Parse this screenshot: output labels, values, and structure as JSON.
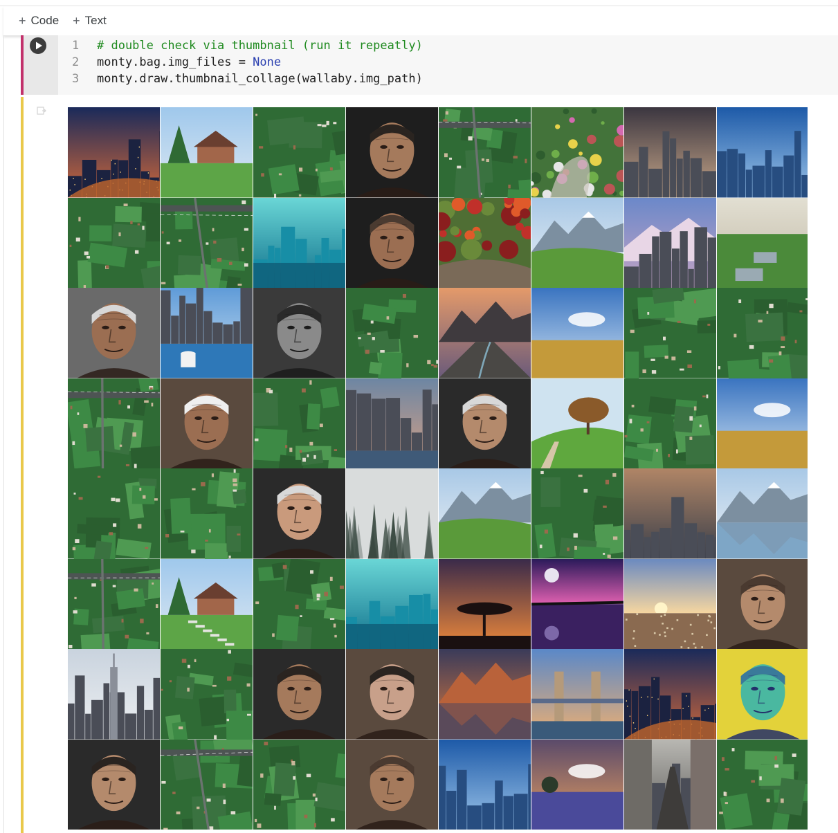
{
  "toolbar": {
    "add_code_label": "Code",
    "add_text_label": "Text"
  },
  "cell": {
    "lines": [
      {
        "n": "1",
        "tokens": [
          {
            "cls": "tok-comment",
            "t": "# double check via thumbnail (run it repeatly)"
          }
        ]
      },
      {
        "n": "2",
        "tokens": [
          {
            "cls": "tok-plain",
            "t": "monty.bag.img_files = "
          },
          {
            "cls": "tok-const",
            "t": "None"
          }
        ]
      },
      {
        "n": "3",
        "tokens": [
          {
            "cls": "tok-plain",
            "t": "monty.draw.thumbnail_collage(wallaby.img_path)"
          }
        ]
      }
    ]
  },
  "collage": {
    "tiles": [
      "city-night",
      "house",
      "aerial",
      "portrait",
      "aerial-road",
      "garden",
      "city",
      "city-blue",
      "aerial",
      "aerial-road",
      "teal-city",
      "portrait",
      "autumn",
      "mountains",
      "city-mountain",
      "park-water",
      "portrait",
      "city-lake",
      "portrait-bw",
      "aerial",
      "canyon",
      "field-sky",
      "aerial",
      "aerial",
      "aerial-road",
      "portrait",
      "aerial",
      "city-harbor",
      "portrait",
      "tree-hill",
      "aerial",
      "field-sky",
      "aerial",
      "aerial",
      "portrait",
      "fog-forest",
      "mountains",
      "aerial",
      "city-haze",
      "mountain-lake",
      "aerial-road",
      "garden-path",
      "aerial",
      "teal-city",
      "sunset-tree",
      "moon-purple",
      "sunrise-city",
      "portrait",
      "empire",
      "aerial",
      "portrait",
      "portrait",
      "mountain-reflect",
      "bridge",
      "city-night",
      "portrait-green",
      "portrait",
      "aerial-road",
      "aerial",
      "portrait",
      "city-blue",
      "field-sunset",
      "street",
      "aerial"
    ],
    "palette": {
      "aerial": "#2f7a3e",
      "sky": "#8fb8dd",
      "skin": "#b48868"
    }
  }
}
